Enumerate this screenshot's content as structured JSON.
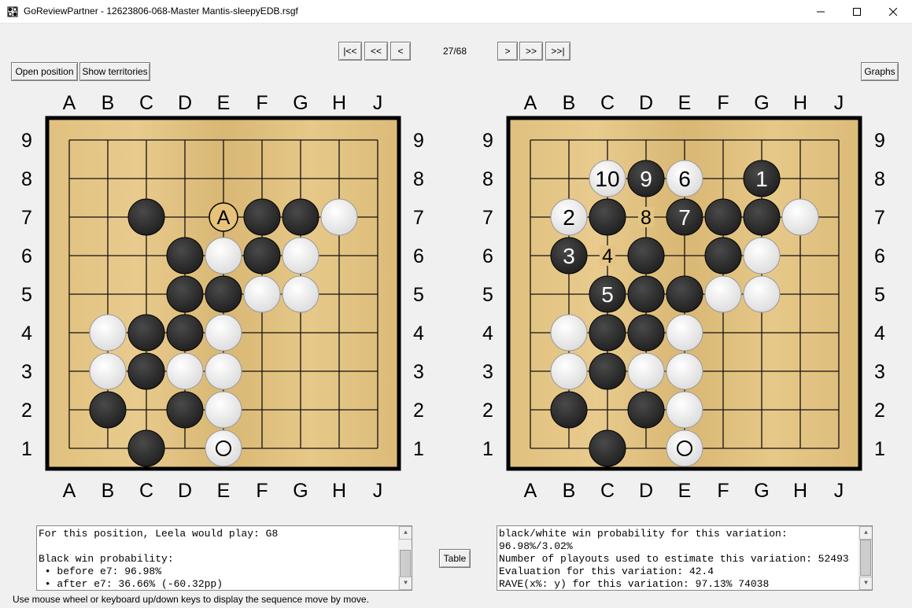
{
  "window": {
    "title": "GoReviewPartner - 12623806-068-Master Mantis-sleepyEDB.rsgf"
  },
  "nav": {
    "first": "|<<",
    "prev_fast": "<<",
    "prev": "<",
    "counter": "27/68",
    "next": ">",
    "next_fast": ">>",
    "last": ">>|"
  },
  "toolbar": {
    "open_position": "Open position",
    "show_territories": "Show territories",
    "graphs": "Graphs",
    "table": "Table"
  },
  "board": {
    "columns": [
      "A",
      "B",
      "C",
      "D",
      "E",
      "F",
      "G",
      "H",
      "J"
    ],
    "rows": [
      "9",
      "8",
      "7",
      "6",
      "5",
      "4",
      "3",
      "2",
      "1"
    ],
    "colors": {
      "wood": "#e2c382",
      "grid": "#111111",
      "black_stone": "#1e1e1e",
      "white_stone": "#f3f3f3",
      "candidate_fill": "#e6c27a"
    }
  },
  "left_board": {
    "stones": [
      {
        "c": "B",
        "p": "C7"
      },
      {
        "c": "B",
        "p": "F7"
      },
      {
        "c": "B",
        "p": "G7"
      },
      {
        "c": "W",
        "p": "H7"
      },
      {
        "c": "B",
        "p": "D6"
      },
      {
        "c": "W",
        "p": "E6"
      },
      {
        "c": "B",
        "p": "F6"
      },
      {
        "c": "W",
        "p": "G6"
      },
      {
        "c": "B",
        "p": "D5"
      },
      {
        "c": "B",
        "p": "E5"
      },
      {
        "c": "W",
        "p": "F5"
      },
      {
        "c": "W",
        "p": "G5"
      },
      {
        "c": "W",
        "p": "B4"
      },
      {
        "c": "B",
        "p": "C4"
      },
      {
        "c": "B",
        "p": "D4"
      },
      {
        "c": "W",
        "p": "E4"
      },
      {
        "c": "W",
        "p": "B3"
      },
      {
        "c": "B",
        "p": "C3"
      },
      {
        "c": "W",
        "p": "D3"
      },
      {
        "c": "W",
        "p": "E3"
      },
      {
        "c": "B",
        "p": "B2"
      },
      {
        "c": "B",
        "p": "D2"
      },
      {
        "c": "W",
        "p": "E2"
      },
      {
        "c": "B",
        "p": "C1"
      },
      {
        "c": "W",
        "p": "E1",
        "last": true
      }
    ],
    "candidates": [
      {
        "p": "E7",
        "label": "A"
      }
    ]
  },
  "right_board": {
    "stones": [
      {
        "c": "W",
        "p": "C8",
        "label": "10"
      },
      {
        "c": "B",
        "p": "D8",
        "label": "9"
      },
      {
        "c": "W",
        "p": "E8",
        "label": "6"
      },
      {
        "c": "B",
        "p": "G8",
        "label": "1"
      },
      {
        "c": "W",
        "p": "B7",
        "label": "2"
      },
      {
        "c": "B",
        "p": "C7"
      },
      {
        "c": "B",
        "p": "E7",
        "label": "7"
      },
      {
        "c": "B",
        "p": "F7"
      },
      {
        "c": "B",
        "p": "G7"
      },
      {
        "c": "W",
        "p": "H7"
      },
      {
        "c": "B",
        "p": "B6",
        "label": "3"
      },
      {
        "c": "B",
        "p": "D6"
      },
      {
        "c": "B",
        "p": "F6"
      },
      {
        "c": "W",
        "p": "G6"
      },
      {
        "c": "B",
        "p": "C5",
        "label": "5"
      },
      {
        "c": "B",
        "p": "D5"
      },
      {
        "c": "B",
        "p": "E5"
      },
      {
        "c": "W",
        "p": "F5"
      },
      {
        "c": "W",
        "p": "G5"
      },
      {
        "c": "W",
        "p": "B4"
      },
      {
        "c": "B",
        "p": "C4"
      },
      {
        "c": "B",
        "p": "D4"
      },
      {
        "c": "W",
        "p": "E4"
      },
      {
        "c": "W",
        "p": "B3"
      },
      {
        "c": "B",
        "p": "C3"
      },
      {
        "c": "W",
        "p": "D3"
      },
      {
        "c": "W",
        "p": "E3"
      },
      {
        "c": "B",
        "p": "B2"
      },
      {
        "c": "B",
        "p": "D2"
      },
      {
        "c": "W",
        "p": "E2"
      },
      {
        "c": "B",
        "p": "C1"
      },
      {
        "c": "W",
        "p": "E1",
        "last": true
      }
    ],
    "point_labels": [
      {
        "p": "D7",
        "label": "8"
      },
      {
        "p": "C6",
        "label": "4"
      }
    ]
  },
  "left_text": {
    "lines": [
      "For this position, Leela would play: G8",
      "",
      "Black win probability:",
      " • before e7: 96.98%",
      " • after e7: 36.66% (-60.32pp)"
    ]
  },
  "right_text": {
    "lines": [
      "black/white win probability for this variation:",
      "96.98%/3.02%",
      "Number of playouts used to estimate this variation: 52493",
      "Evaluation for this variation: 42.4",
      "RAVE(x%: y) for this variation: 97.13% 74038"
    ]
  },
  "status": {
    "text": "Use mouse wheel or keyboard up/down keys to display the sequence move by move."
  }
}
